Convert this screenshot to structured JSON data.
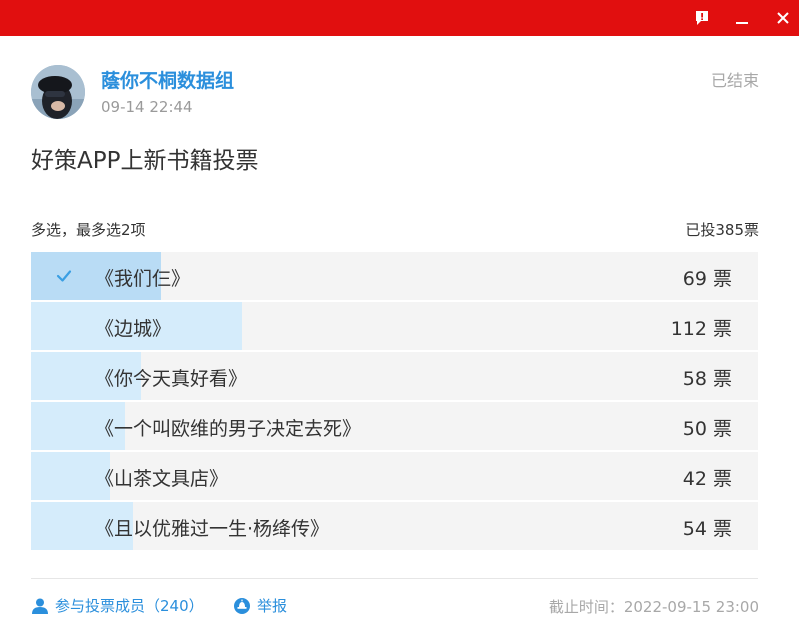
{
  "window": {
    "feedback_icon": "feedback-icon",
    "minimize_icon": "minimize-icon",
    "close_icon": "close-icon",
    "titlebar_color": "#e10f0f"
  },
  "post": {
    "author": "蔭你不桐数据组",
    "time": "09-14 22:44",
    "status": "已结束",
    "title": "好策APP上新书籍投票"
  },
  "poll": {
    "rule": "多选，最多选2项",
    "total": "已投385票",
    "options": [
      {
        "label": "《我们仨》",
        "count": "69 票",
        "votes": 69,
        "selected": true
      },
      {
        "label": "《边城》",
        "count": "112 票",
        "votes": 112,
        "selected": false
      },
      {
        "label": "《你今天真好看》",
        "count": "58 票",
        "votes": 58,
        "selected": false
      },
      {
        "label": "《一个叫欧维的男子决定去死》",
        "count": "50 票",
        "votes": 50,
        "selected": false
      },
      {
        "label": "《山茶文具店》",
        "count": "42 票",
        "votes": 42,
        "selected": false
      },
      {
        "label": "《且以优雅过一生·杨绛传》",
        "count": "54 票",
        "votes": 54,
        "selected": false
      }
    ]
  },
  "footer": {
    "members": "参与投票成员（240）",
    "report": "举报",
    "deadline": "截止时间：2022-09-15 23:00"
  },
  "colors": {
    "accent": "#2b8fdc",
    "bar_fill": "#d5ecfb",
    "bar_fill_selected": "#b9dcf5",
    "bar_bg": "#f4f4f4"
  }
}
